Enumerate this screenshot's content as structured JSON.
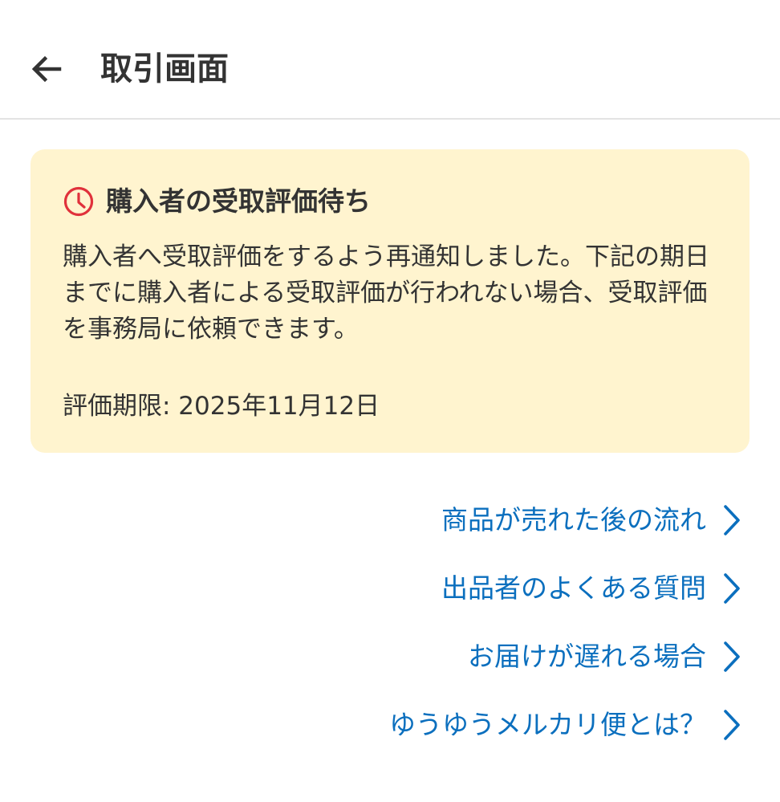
{
  "header": {
    "title": "取引画面",
    "back_icon": "back-arrow-icon"
  },
  "status_card": {
    "icon": "clock-icon",
    "title": "購入者の受取評価待ち",
    "message": "購入者へ受取評価をするよう再通知しました。下記の期日までに購入者による受取評価が行われない場合、受取評価を事務局に依頼できます。",
    "deadline": "評価期限: 2025年11月12日",
    "background_color": "#fff4cf",
    "icon_color": "#e0313b"
  },
  "help_links": [
    {
      "label": "商品が売れた後の流れ"
    },
    {
      "label": "出品者のよくある質問"
    },
    {
      "label": "お届けが遅れる場合"
    },
    {
      "label": "ゆうゆうメルカリ便とは？"
    }
  ],
  "colors": {
    "link": "#0b6fbe",
    "text": "#333333",
    "divider": "#e3e3e3"
  }
}
